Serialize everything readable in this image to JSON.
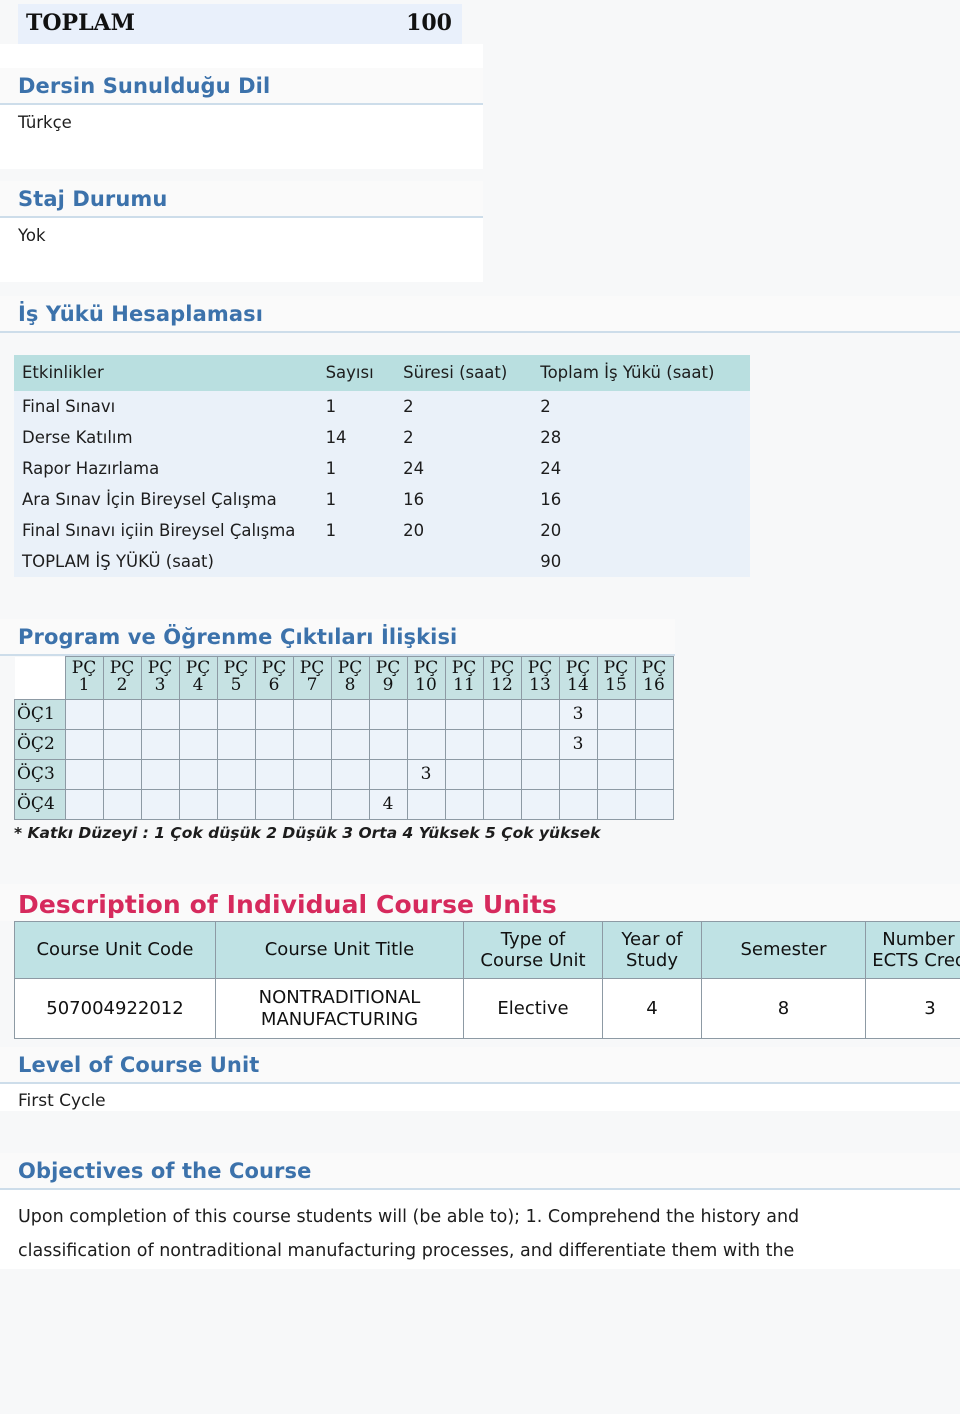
{
  "colors": {
    "heading_blue": "#3c72ab",
    "heading_pink": "#d62a5d",
    "table_header_teal": "#b9dfe0",
    "table_row_blue": "#eaf1f9",
    "total_row_blue": "#e9f0fb",
    "page_bg": "#f7f8f9"
  },
  "total_row": {
    "label": "TOPLAM",
    "value": "100"
  },
  "sections": {
    "language": {
      "heading": "Dersin Sunulduğu Dil",
      "value": "Türkçe"
    },
    "internship": {
      "heading": "Staj Durumu",
      "value": "Yok"
    },
    "workload": {
      "heading": "İş Yükü Hesaplaması"
    },
    "matrix": {
      "heading": "Program ve Öğrenme Çıktıları İlişkisi",
      "note": "* Katkı Düzeyi : 1 Çok düşük 2 Düşük 3 Orta 4 Yüksek 5 Çok yüksek"
    },
    "description": {
      "heading": "Description of Individual Course Units"
    },
    "level": {
      "heading": "Level of Course Unit",
      "value": "First Cycle"
    },
    "objectives": {
      "heading": "Objectives of the Course",
      "line1": "Upon completion of this course students will (be able to); 1. Comprehend the history and",
      "line2": "classification of nontraditional manufacturing processes, and differentiate them with the"
    }
  },
  "workload_table": {
    "columns": [
      "Etkinlikler",
      "Sayısı",
      "Süresi (saat)",
      "Toplam İş Yükü (saat)"
    ],
    "rows": [
      {
        "activity": "Final Sınavı",
        "count": "1",
        "duration": "2",
        "total": "2"
      },
      {
        "activity": "Derse Katılım",
        "count": "14",
        "duration": "2",
        "total": "28"
      },
      {
        "activity": "Rapor Hazırlama",
        "count": "1",
        "duration": "24",
        "total": "24"
      },
      {
        "activity": "Ara Sınav İçin Bireysel Çalışma",
        "count": "1",
        "duration": "16",
        "total": "16"
      },
      {
        "activity": "Final Sınavı içiin Bireysel Çalışma",
        "count": "1",
        "duration": "20",
        "total": "20"
      },
      {
        "activity": "TOPLAM İŞ YÜKÜ (saat)",
        "count": "",
        "duration": "",
        "total": "90"
      }
    ]
  },
  "matrix_table": {
    "col_prefix": "PÇ",
    "col_numbers": [
      "1",
      "2",
      "3",
      "4",
      "5",
      "6",
      "7",
      "8",
      "9",
      "10",
      "11",
      "12",
      "13",
      "14",
      "15",
      "16"
    ],
    "row_labels": [
      "ÖÇ1",
      "ÖÇ2",
      "ÖÇ3",
      "ÖÇ4"
    ],
    "values": [
      [
        "",
        "",
        "",
        "",
        "",
        "",
        "",
        "",
        "",
        "",
        "",
        "",
        "",
        "3",
        "",
        ""
      ],
      [
        "",
        "",
        "",
        "",
        "",
        "",
        "",
        "",
        "",
        "",
        "",
        "",
        "",
        "3",
        "",
        ""
      ],
      [
        "",
        "",
        "",
        "",
        "",
        "",
        "",
        "",
        "",
        "3",
        "",
        "",
        "",
        "",
        "",
        ""
      ],
      [
        "",
        "",
        "",
        "",
        "",
        "",
        "",
        "",
        "4",
        "",
        "",
        "",
        "",
        "",
        "",
        ""
      ]
    ]
  },
  "course_units_table": {
    "columns": [
      "Course Unit Code",
      "Course Unit Title",
      "Type of Course Unit",
      "Year of Study",
      "Semester",
      "Number of ECTS Credits"
    ],
    "rows": [
      {
        "code": "507004922012",
        "title": "NONTRADITIONAL MANUFACTURING",
        "type": "Elective",
        "year": "4",
        "semester": "8",
        "ects": "3"
      }
    ]
  }
}
